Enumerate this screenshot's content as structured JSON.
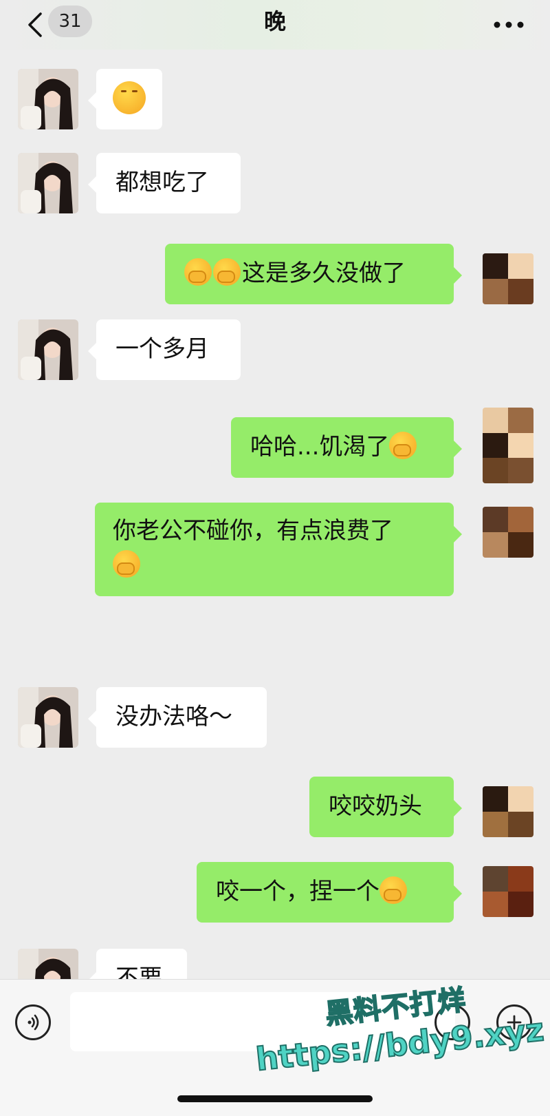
{
  "header": {
    "unread_count": "31",
    "title": "晚"
  },
  "messages": [
    {
      "from": "contact",
      "text": "",
      "emoji": "blush"
    },
    {
      "from": "contact",
      "text": "都想吃了"
    },
    {
      "from": "me",
      "text": "这是多久没做了",
      "emoji_prefix": "smirk x2"
    },
    {
      "from": "contact",
      "text": "一个多月"
    },
    {
      "from": "me",
      "text": "哈哈...饥渴了",
      "emoji_suffix": "smirk"
    },
    {
      "from": "me",
      "text": "你老公不碰你，有点浪费了",
      "emoji_suffix": "smirk"
    },
    {
      "from": "contact",
      "text": "没办法咯～"
    },
    {
      "from": "me",
      "text": "咬咬奶头"
    },
    {
      "from": "me",
      "text": "咬一个，捏一个",
      "emoji_suffix": "smirk"
    },
    {
      "from": "contact",
      "text": "不要"
    }
  ],
  "watermark": {
    "line1": "黑料不打烊",
    "line2": "https://bdy9.xyz"
  },
  "colors": {
    "outgoing_bubble": "#95ec69",
    "incoming_bubble": "#ffffff",
    "background": "#ededed"
  }
}
